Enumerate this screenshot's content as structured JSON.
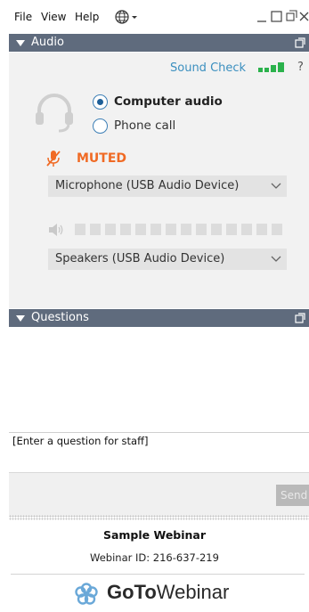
{
  "menu": {
    "file": "File",
    "view": "View",
    "help": "Help"
  },
  "audio": {
    "header": "Audio",
    "sound_check": "Sound Check",
    "help_mark": "?",
    "options": [
      {
        "label": "Computer audio",
        "selected": true
      },
      {
        "label": "Phone call",
        "selected": false
      }
    ],
    "mute_status": "MUTED",
    "microphone": "Microphone (USB Audio Device)",
    "speakers": "Speakers (USB Audio Device)",
    "volume_level": 0
  },
  "questions": {
    "header": "Questions",
    "input_value": "[Enter a question for staff]",
    "send_label": "Send"
  },
  "webinar": {
    "title": "Sample Webinar",
    "id_line": "Webinar ID: 216-637-219"
  },
  "brand": {
    "name_bold": "GoTo",
    "name_light": "Webinar"
  },
  "colors": {
    "header_bg": "#5f6b7d",
    "link": "#3b8fbf",
    "muted": "#f06a24",
    "signal": "#2bb24c",
    "brand_icon": "#6aa8d8"
  },
  "icons": {
    "globe": "globe-icon",
    "headset": "headset-icon",
    "mic_muted": "microphone-muted-icon",
    "speaker": "speaker-icon",
    "popout": "popout-icon"
  }
}
